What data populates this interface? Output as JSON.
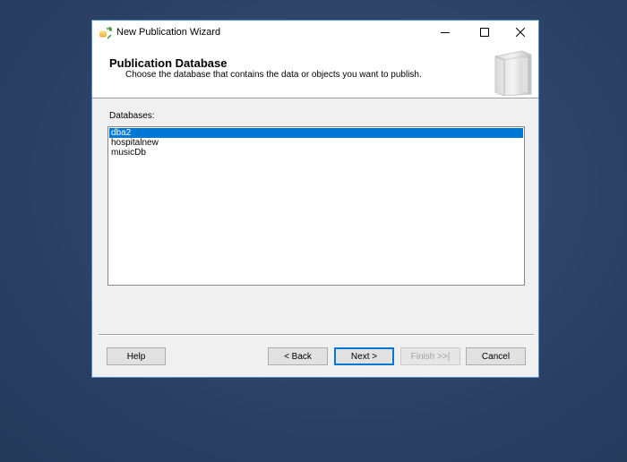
{
  "window": {
    "title": "New Publication Wizard",
    "minimize_icon": "minimize-icon",
    "maximize_icon": "maximize-icon",
    "close_icon": "close-icon"
  },
  "header": {
    "title": "Publication Database",
    "description": "Choose the database that contains the data or objects you want to publish."
  },
  "databases": {
    "label": "Databases:",
    "items": [
      "dba2",
      "hospitalnew",
      "musicDb"
    ],
    "selected": "dba2"
  },
  "buttons": {
    "help": "Help",
    "back": "< Back",
    "next": "Next >",
    "finish": "Finish >>|",
    "cancel": "Cancel"
  },
  "colors": {
    "selection": "#0078d7",
    "window_border": "#4a90d9",
    "desktop": "#2c4266"
  }
}
